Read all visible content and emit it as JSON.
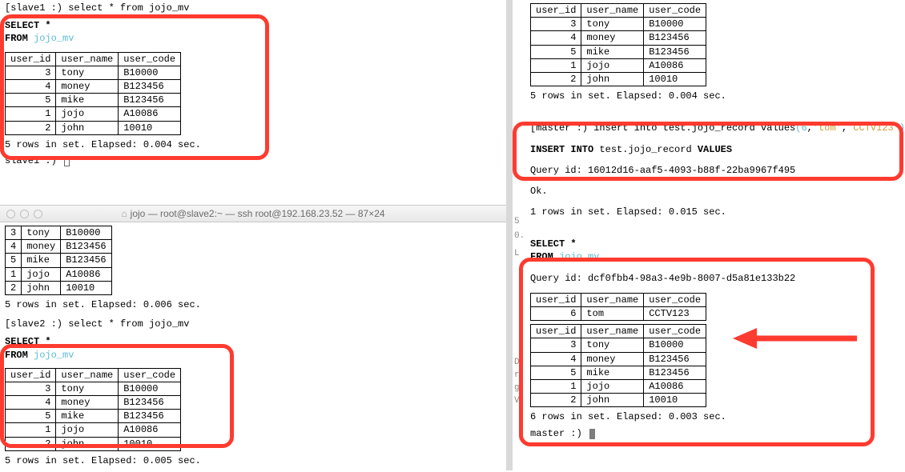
{
  "common_table": {
    "headers": [
      "user_id",
      "user_name",
      "user_code"
    ],
    "rows": [
      {
        "id": "3",
        "name": "tony",
        "code": "B10000"
      },
      {
        "id": "4",
        "name": "money",
        "code": "B123456"
      },
      {
        "id": "5",
        "name": "mike",
        "code": "B123456"
      },
      {
        "id": "1",
        "name": "jojo",
        "code": "A10086"
      },
      {
        "id": "2",
        "name": "john",
        "code": "10010"
      }
    ]
  },
  "new_row": {
    "id": "6",
    "name": "tom",
    "code": "CCTV123"
  },
  "slave1": {
    "prompt_open": "[slave1 :) select * from jojo_mv",
    "select": "SELECT *",
    "from_kw": "FROM ",
    "from_tbl": "jojo_mv",
    "status": "5 rows in set. Elapsed: 0.004 sec.",
    "next_prompt": "slave1 :) "
  },
  "slave2": {
    "titlebar": "jojo — root@slave2:~ — ssh root@192.168.23.52 — 87×24",
    "top_status": "5 rows in set. Elapsed: 0.006 sec.",
    "prompt": "[slave2 :) select * from jojo_mv",
    "select": "SELECT *",
    "from_kw": "FROM ",
    "from_tbl": "jojo_mv",
    "bottom_status": "5 rows in set. Elapsed: 0.005 sec."
  },
  "master": {
    "insert_prompt_prefix": "[master :) insert into test.jojo_record values",
    "insert_args_open": "(",
    "insert_arg_num": "6",
    "insert_comma1": ",",
    "insert_arg_str1": "'tom'",
    "insert_comma2": ",",
    "insert_arg_str2": "'CCTV123'",
    "insert_args_close": ");",
    "insert_echo_1": "INSERT INTO",
    "insert_echo_2": " test.jojo_record ",
    "insert_echo_3": "VALUES",
    "query_id_insert": "Query id: 16012d16-aaf5-4093-b88f-22ba9967f495",
    "ok": "Ok.",
    "rows_insert": "1 rows in set. Elapsed: 0.015 sec.",
    "top_status_cut": "5 rows in set. Elapsed: 0.004 sec.",
    "select": "SELECT *",
    "from_kw": "FROM ",
    "from_tbl": "jojo_mv",
    "query_id_select": "Query id: dcf0fbb4-98a3-4e9b-8007-d5a81e133b22",
    "final_status": "6 rows in set. Elapsed: 0.003 sec.",
    "next_prompt": "master :) "
  },
  "gutter_chars": {
    "a": "5",
    "b": "0.",
    "c": "L",
    "d": "D",
    "e": "r",
    "f": "g",
    "g": "V"
  }
}
